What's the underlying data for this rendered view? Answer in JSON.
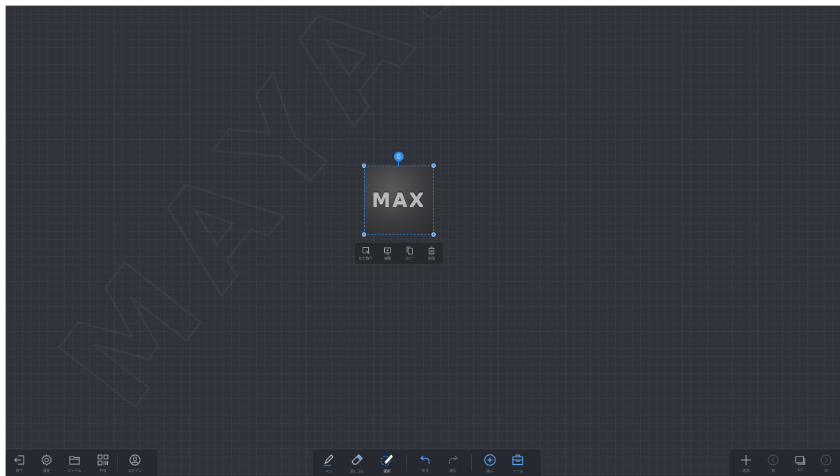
{
  "watermark": {
    "text": "MAYASYS"
  },
  "selected_object": {
    "logo_text": "MAX"
  },
  "context_menu": {
    "items": [
      {
        "icon": "crop-icon",
        "label": "切り取り"
      },
      {
        "icon": "screen-icon",
        "label": "複製"
      },
      {
        "icon": "copy-icon",
        "label": "コピー"
      },
      {
        "icon": "trash-icon",
        "label": "削除"
      }
    ]
  },
  "left_toolbar": {
    "items": [
      {
        "icon": "exit-icon",
        "label": "終了"
      },
      {
        "icon": "gear-icon",
        "label": "設定"
      },
      {
        "icon": "folder-icon",
        "label": "ファイル"
      },
      {
        "icon": "qr-code-icon",
        "label": "共有"
      },
      {
        "icon": "user-icon",
        "label": "ログイン"
      }
    ]
  },
  "center_toolbar": {
    "items": [
      {
        "icon": "pen-icon",
        "label": "ペン"
      },
      {
        "icon": "eraser-icon",
        "label": "消しゴム"
      },
      {
        "icon": "select-icon",
        "label": "選択"
      },
      {
        "icon": "undo-icon",
        "label": "戻る"
      },
      {
        "icon": "redo-icon",
        "label": "進む"
      },
      {
        "icon": "insert-icon",
        "label": "挿入"
      },
      {
        "icon": "toolbox-icon",
        "label": "ツール"
      }
    ]
  },
  "right_toolbar": {
    "items": [
      {
        "icon": "plus-icon",
        "label": "追加"
      },
      {
        "icon": "prev-icon",
        "label": "前"
      },
      {
        "icon": "pages-icon",
        "label": "1/1"
      },
      {
        "icon": "next-icon",
        "label": "次"
      }
    ]
  },
  "colors": {
    "accent": "#2b8ef0",
    "canvas": "#30343a",
    "toolbar": "#262a30",
    "icon": "#9aa0a8"
  }
}
